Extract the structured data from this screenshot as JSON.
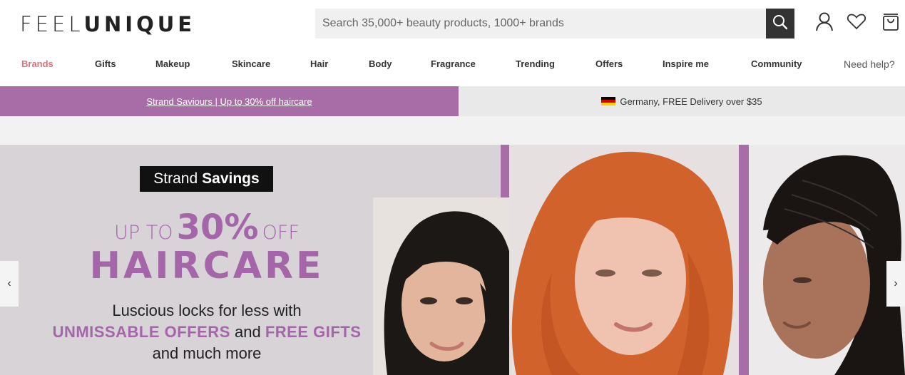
{
  "brand": {
    "logo_light": "FEEL",
    "logo_bold": "UNIQUE"
  },
  "search": {
    "placeholder": "Search 35,000+ beauty products, 1000+ brands"
  },
  "header_icons": [
    "search-icon",
    "account-icon",
    "wishlist-heart-icon",
    "basket-icon"
  ],
  "nav": {
    "items": [
      "Brands",
      "Gifts",
      "Makeup",
      "Skincare",
      "Hair",
      "Body",
      "Fragrance",
      "Trending",
      "Offers",
      "Inspire me",
      "Community"
    ],
    "help": "Need help?"
  },
  "promo": {
    "link": "Strand Saviours | Up to 30% off haircare",
    "delivery": "Germany, FREE Delivery over $35"
  },
  "hero": {
    "tag_light": "Strand",
    "tag_bold": "Savings",
    "upto_a": "UP TO",
    "upto_big": "30%",
    "upto_b": "OFF",
    "headline": "HAIRCARE",
    "copy_line1": "Luscious locks for less with",
    "copy_hl1": "UNMISSABLE OFFERS",
    "copy_and": "and",
    "copy_hl2": "FREE GIFTS",
    "copy_line3": "and much more"
  },
  "colors": {
    "accent": "#a86ca6",
    "nav_active": "#e0707f",
    "hero_bg": "#d7d3d7"
  }
}
